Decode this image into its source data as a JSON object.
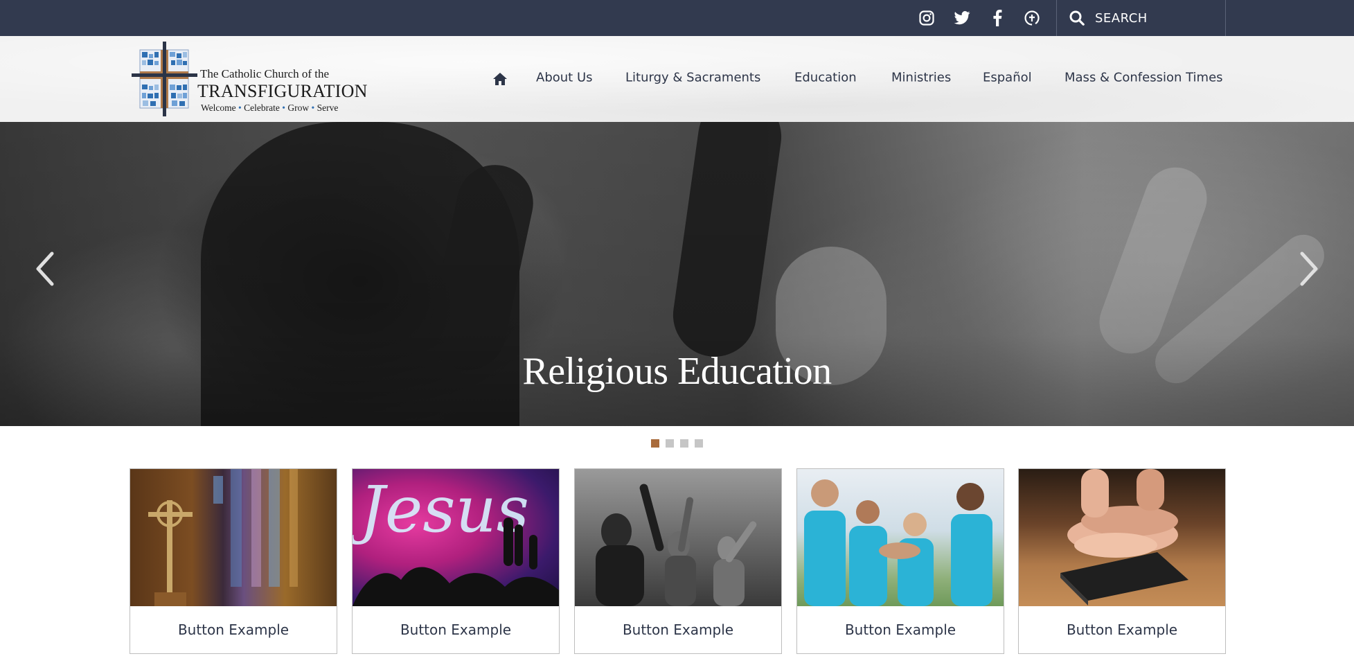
{
  "topbar": {
    "social": [
      {
        "name": "instagram-icon"
      },
      {
        "name": "twitter-icon"
      },
      {
        "name": "facebook-icon"
      },
      {
        "name": "flocknote-icon"
      }
    ],
    "search_placeholder": "SEARCH"
  },
  "logo": {
    "line1": "The Catholic Church of the",
    "line2": "TRANSFIGURATION",
    "tagline": [
      "Welcome",
      "Celebrate",
      "Grow",
      "Serve"
    ]
  },
  "nav": {
    "items": [
      {
        "label": "About Us"
      },
      {
        "label": "Liturgy & Sacraments"
      },
      {
        "label": "Education"
      },
      {
        "label": "Ministries"
      },
      {
        "label": "Español"
      },
      {
        "label": "Mass & Confession Times"
      }
    ]
  },
  "hero": {
    "title": "Religious Education",
    "slide_count": 4,
    "active_slide": 1
  },
  "cards": [
    {
      "label": "Button Example",
      "image": "altar-cross-stained-glass"
    },
    {
      "label": "Button Example",
      "image": "jesus-neon-sign-worship"
    },
    {
      "label": "Button Example",
      "image": "worship-crowd-hands-raised"
    },
    {
      "label": "Button Example",
      "image": "volunteers-hands-together"
    },
    {
      "label": "Button Example",
      "image": "hands-on-bible"
    }
  ],
  "colors": {
    "topbar": "#323a4f",
    "header": "#f1f1f1",
    "text": "#2d3548",
    "accent": "#a96b3b",
    "dot_inactive": "#c6c6c6"
  }
}
